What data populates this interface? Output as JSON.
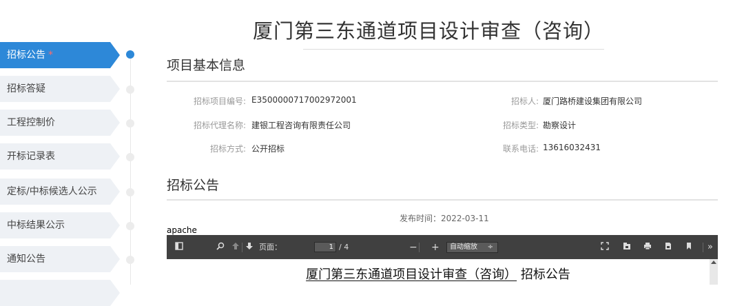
{
  "page": {
    "title": "厦门第三东通道项目设计审查（咨询）"
  },
  "sidebar": {
    "items": [
      {
        "label": "招标公告",
        "required_mark": "*",
        "active": true
      },
      {
        "label": "招标答疑"
      },
      {
        "label": "工程控制价"
      },
      {
        "label": "开标记录表"
      },
      {
        "label": "定标/中标候选人公示"
      },
      {
        "label": "中标结果公示"
      },
      {
        "label": "通知公告"
      }
    ]
  },
  "basic_info": {
    "section_title": "项目基本信息",
    "rows": [
      {
        "l1": "招标项目编号:",
        "v1": "E3500000717002972001",
        "l2": "招标人:",
        "v2": "厦门路桥建设集团有限公司"
      },
      {
        "l1": "招标代理名称:",
        "v1": "建银工程咨询有限责任公司",
        "l2": "招标类型:",
        "v2": "勘察设计"
      },
      {
        "l1": "招标方式:",
        "v1": "公开招标",
        "l2": "联系电话:",
        "v2": "13616032431"
      }
    ]
  },
  "announcement": {
    "section_title": "招标公告",
    "publish_label": "发布时间：",
    "publish_date": "2022-03-11"
  },
  "viewer": {
    "apache_text": "apache",
    "page_label": "页面：",
    "current_page": "1",
    "total_pages": "/ 4",
    "zoom_minus": "−",
    "zoom_plus": "+",
    "zoom_value": "自动缩放",
    "doc_heading_underlined": "厦门第三东通道项目设计审查（咨询）",
    "doc_heading_rest": "招标公告"
  },
  "colors": {
    "accent": "#2d88d8",
    "toolbar": "#404040"
  }
}
